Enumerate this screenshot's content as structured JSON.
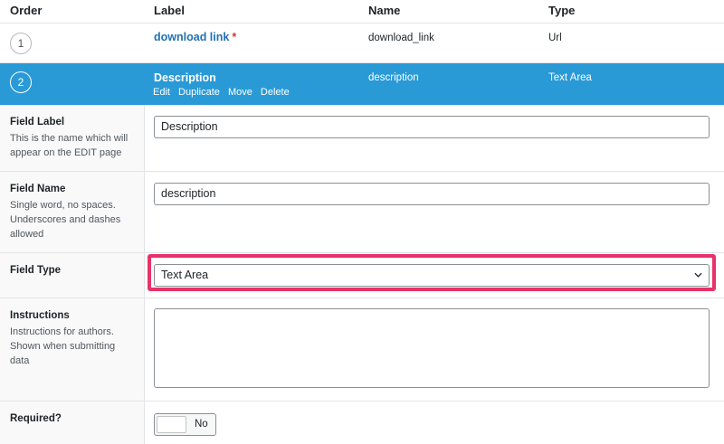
{
  "header": {
    "order": "Order",
    "label": "Label",
    "name": "Name",
    "type": "Type"
  },
  "fields": [
    {
      "order": "1",
      "label": "download link",
      "required_mark": "*",
      "name": "download_link",
      "type": "Url"
    },
    {
      "order": "2",
      "label": "Description",
      "name": "description",
      "type": "Text Area",
      "actions": [
        "Edit",
        "Duplicate",
        "Move",
        "Delete"
      ]
    }
  ],
  "settings": {
    "field_label": {
      "title": "Field Label",
      "desc": "This is the name which will appear on the EDIT page",
      "value": "Description"
    },
    "field_name": {
      "title": "Field Name",
      "desc": "Single word, no spaces. Underscores and dashes allowed",
      "value": "description"
    },
    "field_type": {
      "title": "Field Type",
      "value": "Text Area"
    },
    "instructions": {
      "title": "Instructions",
      "desc": "Instructions for authors. Shown when submitting data",
      "value": ""
    },
    "required": {
      "title": "Required?",
      "toggle_label": "No"
    }
  },
  "colors": {
    "selected_row": "#2a9ad6",
    "highlight": "#e8326a",
    "link": "#2271b1",
    "required": "#d63638"
  }
}
